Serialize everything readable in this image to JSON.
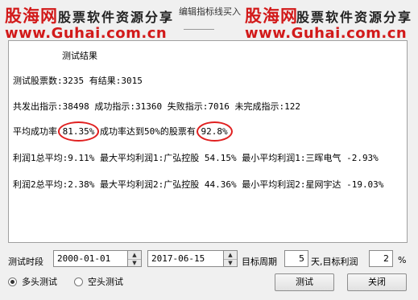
{
  "watermark": {
    "logo": "股海网",
    "slogan": "股票软件资源分享",
    "url": "www.Guhai.com.cn"
  },
  "window": {
    "title": "编辑指标线买入"
  },
  "results": {
    "header": "测试结果",
    "stock_count_line": "测试股票数:3235 有结果:3015",
    "signals_line": "共发出指示:38498 成功指示:31360 失败指示:7016 未完成指示:122",
    "avg_success_prefix": "平均成功率",
    "avg_success_rate": "81.35%",
    "pct_prefix": "成功率达到50%的股票有",
    "pct_value": "92.8%",
    "profit1_line": "利润1总平均:9.11% 最大平均利润1:广弘控股 54.15% 最小平均利润1:三晖电气 -2.93%",
    "profit2_line": "利润2总平均:2.38% 最大平均利润2:广弘控股 44.36% 最小平均利润2:星网宇达 -19.03%"
  },
  "controls": {
    "period_label": "测试时段",
    "start_date": "2000-01-01",
    "end_date": "2017-06-15",
    "target_period_label": "目标周期",
    "target_period_value": "5",
    "day_target_profit_label": "天,目标利润",
    "target_profit_value": "2",
    "percent_sign": "%",
    "long_test_label": "多头测试",
    "short_test_label": "空头测试",
    "selected_mode": "long",
    "test_button": "测试",
    "close_button": "关闭"
  }
}
